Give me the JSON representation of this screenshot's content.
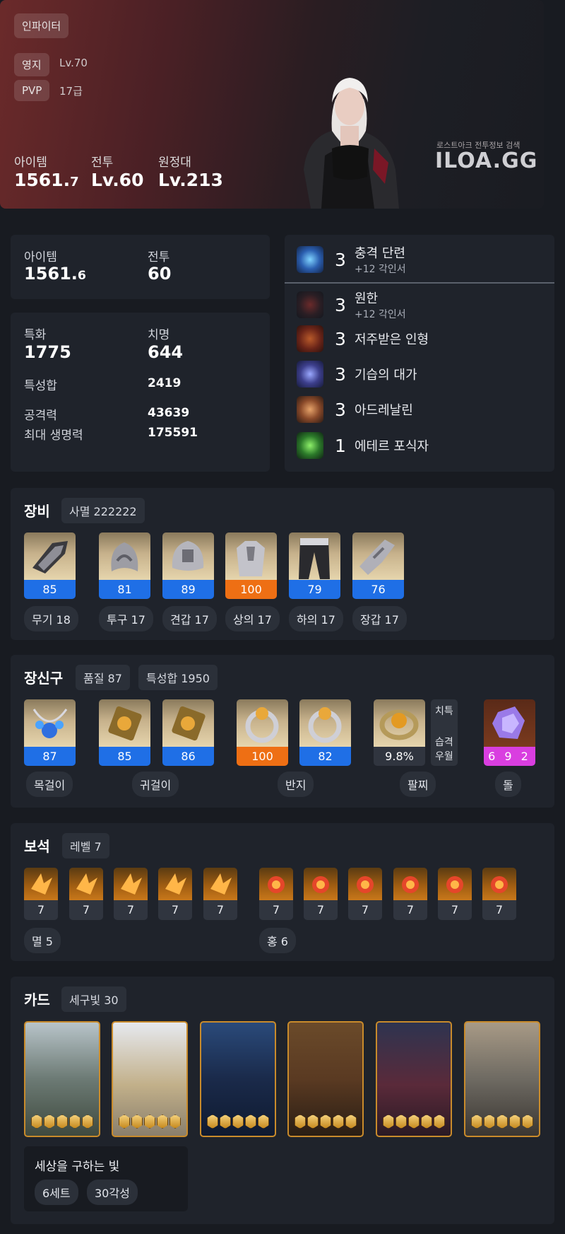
{
  "profile": {
    "class_name": "인파이터",
    "estate_label": "영지",
    "estate_value": "Lv.70",
    "pvp_label": "PVP",
    "pvp_value": "17급",
    "item_label": "아이템",
    "item_value_main": "1561.",
    "item_value_dec": "7",
    "combat_label": "전투",
    "combat_value": "Lv.60",
    "expedition_label": "원정대",
    "expedition_value": "Lv.213",
    "brand_caption": "로스트아크 전투정보 검색",
    "brand_logo": "ILOA.GG"
  },
  "summary": {
    "item_label": "아이템",
    "item_value_main": "1561.",
    "item_value_dec": "6",
    "combat_label": "전투",
    "combat_value": "60"
  },
  "stats": {
    "spec_label": "특화",
    "spec_value": "1775",
    "crit_label": "치명",
    "crit_value": "644",
    "total_label": "특성합",
    "total_value": "2419",
    "atk_label": "공격력",
    "atk_value": "43639",
    "hp_label": "최대 생명력",
    "hp_value": "175591"
  },
  "engravings": [
    {
      "level": "3",
      "name": "충격 단련",
      "sub": "+12 각인서",
      "icon": "shock-training-icon"
    },
    {
      "level": "3",
      "name": "원한",
      "sub": "+12 각인서",
      "icon": "grudge-icon"
    },
    {
      "level": "3",
      "name": "저주받은 인형",
      "sub": "",
      "icon": "cursed-doll-icon"
    },
    {
      "level": "3",
      "name": "기습의 대가",
      "sub": "",
      "icon": "master-of-ambush-icon"
    },
    {
      "level": "3",
      "name": "아드레날린",
      "sub": "",
      "icon": "adrenaline-icon"
    },
    {
      "level": "1",
      "name": "에테르 포식자",
      "sub": "",
      "icon": "ether-predator-icon"
    }
  ],
  "equipment": {
    "title": "장비",
    "set_badge": "사멸 222222",
    "items": [
      {
        "quality": "85",
        "label": "무기 18",
        "icon": "weapon-gauntlet-icon"
      },
      {
        "quality": "81",
        "label": "투구 17",
        "icon": "helmet-icon"
      },
      {
        "quality": "89",
        "label": "견갑 17",
        "icon": "shoulder-icon"
      },
      {
        "quality": "100",
        "label": "상의 17",
        "icon": "chest-armor-icon"
      },
      {
        "quality": "79",
        "label": "하의 17",
        "icon": "pants-icon"
      },
      {
        "quality": "76",
        "label": "장갑 17",
        "icon": "gloves-icon"
      }
    ]
  },
  "accessories": {
    "title": "장신구",
    "quality_badge": "품질 87",
    "stat_badge": "특성합 1950",
    "items": [
      {
        "quality": "87",
        "icon": "necklace-icon"
      },
      {
        "quality": "85",
        "icon": "earring-icon"
      },
      {
        "quality": "86",
        "icon": "earring-icon"
      },
      {
        "quality": "100",
        "icon": "ring-icon"
      },
      {
        "quality": "82",
        "icon": "ring-icon"
      }
    ],
    "labels": {
      "necklace": "목걸이",
      "earrings": "귀걸이",
      "rings": "반지",
      "bracelet": "팔찌",
      "stone": "돌"
    },
    "bracelet": {
      "value": "9.8%",
      "tag1": "치특",
      "tag2a": "습격",
      "tag2b": "우월"
    },
    "stone": {
      "value": "6 9 2"
    }
  },
  "gems": {
    "title": "보석",
    "level_badge": "레벨 7",
    "left_levels": [
      "7",
      "7",
      "7",
      "7",
      "7"
    ],
    "right_levels": [
      "7",
      "7",
      "7",
      "7",
      "7",
      "7"
    ],
    "left_label": "멸 5",
    "right_label": "홍 6"
  },
  "cards": {
    "title": "카드",
    "set_badge": "세구빛 30",
    "set_name": "세상을 구하는 빛",
    "set_tag1": "6세트",
    "set_tag2": "30각성",
    "card_icons": [
      "elf-card-icon",
      "angel-card-icon",
      "dark-knight-card-icon",
      "armored-warrior-card-icon",
      "hooded-man-card-icon",
      "knight-card-icon"
    ],
    "stars_per_card": 5
  },
  "colors": {
    "accent_blue": "#1f6fe6",
    "accent_orange": "#ee6f14",
    "accent_pink": "#d93ee0",
    "panel_bg": "#1f232b",
    "page_bg": "#181b21"
  }
}
